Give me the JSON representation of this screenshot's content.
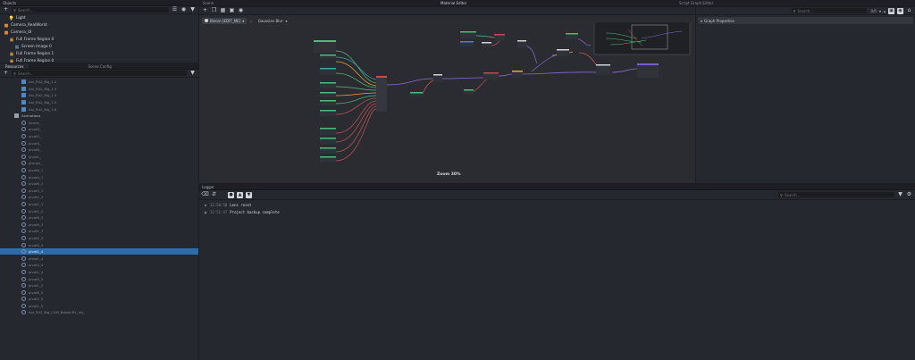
{
  "objects_panel": {
    "title": "Objects",
    "search_placeholder": "Search...",
    "items": [
      {
        "label": "Light",
        "icon": "light-bulb-icon",
        "indent": 1
      },
      {
        "label": "Camera_RealWorld",
        "icon": "camera-icon",
        "indent": 0
      },
      {
        "label": "Camera_UI",
        "icon": "camera-icon",
        "indent": 0
      },
      {
        "label": "Full Frame Region 0",
        "icon": "region-icon",
        "indent": 1
      },
      {
        "label": "Screen Image 0",
        "icon": "image-icon",
        "indent": 2
      },
      {
        "label": "Full Frame Region 1",
        "icon": "region-icon",
        "indent": 1
      },
      {
        "label": "Full Frame Region 0",
        "icon": "region-icon",
        "indent": 1
      }
    ]
  },
  "resources_panel": {
    "tabs": [
      "Resources",
      "Scene Config"
    ],
    "search_placeholder": "Search...",
    "items": [
      {
        "label": "Ani_R42_Big_1.2",
        "type": "file",
        "indent": 2
      },
      {
        "label": "Ani_R42_Big_1.3",
        "type": "file",
        "indent": 2
      },
      {
        "label": "Ani_R42_Big_1.4",
        "type": "file",
        "indent": 2
      },
      {
        "label": "Ani_R42_Big_1.5",
        "type": "file",
        "indent": 2
      },
      {
        "label": "Ani_R42_Big_1.6",
        "type": "file",
        "indent": 2
      },
      {
        "label": "Animations",
        "type": "folder",
        "indent": 1
      },
      {
        "label": "Scene_",
        "type": "item",
        "indent": 2
      },
      {
        "label": "pivot0_",
        "type": "item",
        "indent": 2
      },
      {
        "label": "pivot2_",
        "type": "item",
        "indent": 2
      },
      {
        "label": "pivot4_",
        "type": "item",
        "indent": 2
      },
      {
        "label": "pivot6_",
        "type": "item",
        "indent": 2
      },
      {
        "label": "pivot1_",
        "type": "item",
        "indent": 2
      },
      {
        "label": "group1_",
        "type": "item",
        "indent": 2
      },
      {
        "label": "pivot6_1",
        "type": "item",
        "indent": 2
      },
      {
        "label": "pivot4_1",
        "type": "item",
        "indent": 2
      },
      {
        "label": "pivot6_2",
        "type": "item",
        "indent": 2
      },
      {
        "label": "pivot3_1",
        "type": "item",
        "indent": 2
      },
      {
        "label": "pivot2_2",
        "type": "item",
        "indent": 2
      },
      {
        "label": "pivot1_1",
        "type": "item",
        "indent": 2
      },
      {
        "label": "pivot1_2",
        "type": "item",
        "indent": 2
      },
      {
        "label": "pivot6_3",
        "type": "item",
        "indent": 2
      },
      {
        "label": "pivot4_3",
        "type": "item",
        "indent": 2
      },
      {
        "label": "pivot1_3",
        "type": "item",
        "indent": 2
      },
      {
        "label": "pivot2_3",
        "type": "item",
        "indent": 2
      },
      {
        "label": "pivot6_4",
        "type": "item",
        "indent": 2
      },
      {
        "label": "pivot1_4",
        "type": "item",
        "indent": 2,
        "selected": true
      },
      {
        "label": "pivot1_4",
        "type": "item",
        "indent": 2
      },
      {
        "label": "pivot2_4",
        "type": "item",
        "indent": 2
      },
      {
        "label": "pivot1_4",
        "type": "item",
        "indent": 2
      },
      {
        "label": "pivot0_5",
        "type": "item",
        "indent": 2
      },
      {
        "label": "pivot1_5",
        "type": "item",
        "indent": 2
      },
      {
        "label": "pivot6_5",
        "type": "item",
        "indent": 2
      },
      {
        "label": "pivot2_5",
        "type": "item",
        "indent": 2
      },
      {
        "label": "pivot1_5",
        "type": "item",
        "indent": 2
      },
      {
        "label": "Ani_R42_Big_CAM_Baked:R1_rot_",
        "type": "item",
        "indent": 2
      }
    ]
  },
  "material_editor": {
    "tabs": [
      "Scene",
      "Material Editor",
      "Script Graph Editor"
    ],
    "breadcrumb_root": "Bloom [EDIT_ME]",
    "breadcrumb_child": "Gaussian Blur",
    "zoom_label": "Zoom 30%",
    "colors": {
      "green": "#4dbb7a",
      "teal": "#3aa5a5",
      "red": "#c94848",
      "purple": "#7b5cc8",
      "blue": "#4c7fd0"
    }
  },
  "graph_properties": {
    "search_placeholder": "Search...",
    "counter": "0/0",
    "section_title": "Graph Properties"
  },
  "logger": {
    "title": "Logger",
    "search_placeholder": "Search...",
    "entries": [
      {
        "time": "12:50:58",
        "message": "Lens reset",
        "icon": "info-icon"
      },
      {
        "time": "12:51:47",
        "message": "Project backup complete",
        "icon": "backup-icon"
      }
    ]
  }
}
